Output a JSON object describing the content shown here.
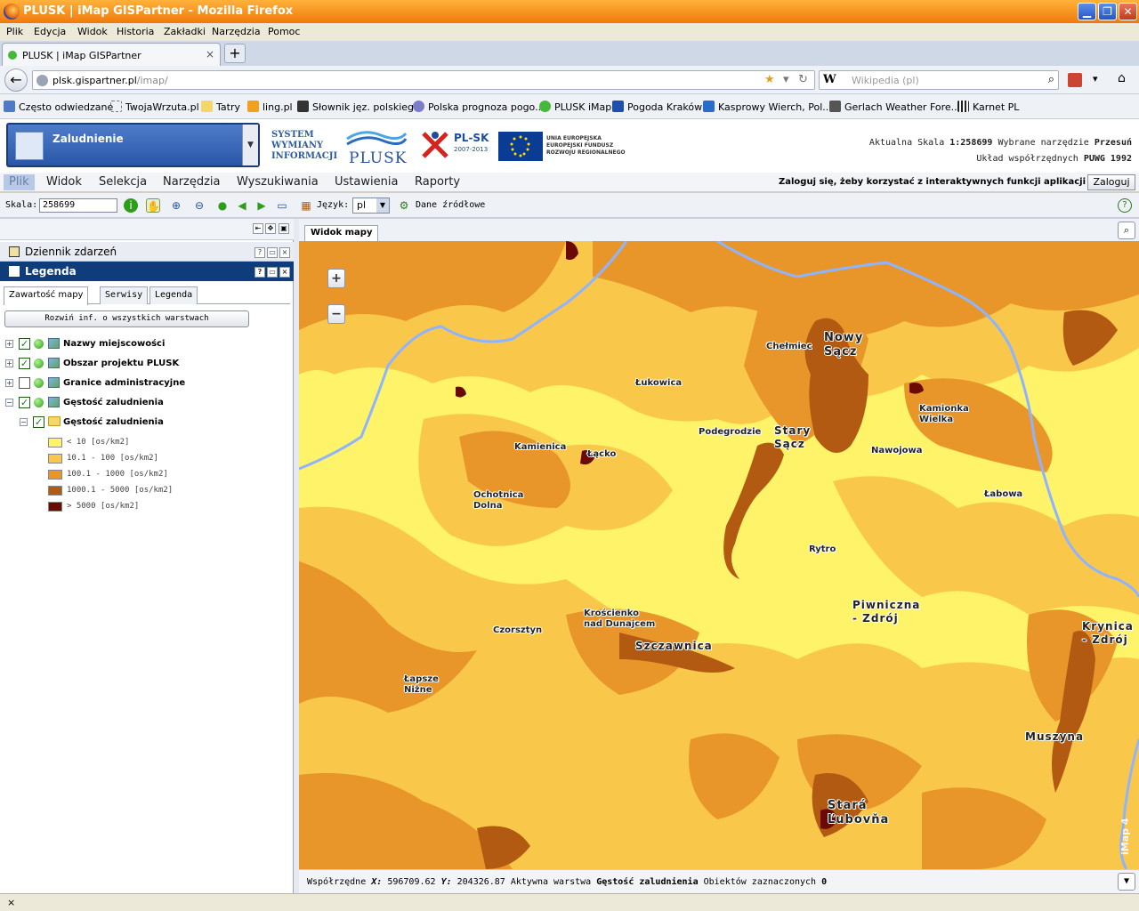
{
  "window": {
    "title": "PLUSK | iMap GISPartner - Mozilla Firefox"
  },
  "menu": [
    "Plik",
    "Edycja",
    "Widok",
    "Historia",
    "Zakładki",
    "Narzędzia",
    "Pomoc"
  ],
  "tab": {
    "label": "PLUSK | iMap GISPartner",
    "new": "+"
  },
  "nav": {
    "url_host": "plsk.gispartner.pl",
    "url_path": "/imap/",
    "search_engine": "W",
    "search_placeholder": "Wikipedia (pl)"
  },
  "bookmarks": [
    "Często odwiedzane",
    "TwojaWrzuta.pl",
    "Tatry",
    "ling.pl",
    "Słownik jęz. polskiego",
    "Polska prognoza pogo...",
    "PLUSK iMap",
    "Pogoda Kraków",
    "Kasprowy Wierch, Pol...",
    "Gerlach Weather Fore...",
    "Karnet PL"
  ],
  "app": {
    "combo_label": "Zaludnienie",
    "system_lines": [
      "SYSTEM",
      "WYMIANY",
      "INFORMACJI"
    ],
    "plusk_logo": "PLUSK",
    "plsk_logo": "PL-SK",
    "plsk_years": "2007-2013",
    "eu_lines": [
      "UNIA EUROPEJSKA",
      "EUROPEJSKI FUNDUSZ",
      "ROZWOJU REGIONALNEGO"
    ],
    "scale_label": "Aktualna Skala",
    "scale_value": "1:258699",
    "tool_label": "Wybrane narzędzie",
    "tool_value": "Przesuń",
    "coords_label": "Układ współrzędnych",
    "coords_value": "PUWG 1992"
  },
  "appmenu": [
    "Plik",
    "Widok",
    "Selekcja",
    "Narzędzia",
    "Wyszukiwania",
    "Ustawienia",
    "Raporty"
  ],
  "login": {
    "text": "Zaloguj się, żeby korzystać z interaktywnych funkcji aplikacji",
    "button": "Zaloguj"
  },
  "toolbar": {
    "scale_label": "Skala:",
    "scale_value": "258699",
    "lang_label": "Język:",
    "lang_value": "pl",
    "source_label": "Dane źródłowe"
  },
  "left": {
    "events": "Dziennik zdarzeń",
    "legend": "Legenda",
    "subtabs": [
      "Zawartość mapy",
      "Serwisy",
      "Legenda"
    ],
    "expand_all": "Rozwiń inf. o wszystkich warstwach",
    "layers": [
      {
        "name": "Nazwy miejscowości",
        "checked": true
      },
      {
        "name": "Obszar projektu PLUSK",
        "checked": true
      },
      {
        "name": "Granice administracyjne",
        "checked": false
      },
      {
        "name": "Gęstość zaludnienia",
        "checked": true
      }
    ],
    "sublayer": "Gęstość zaludnienia",
    "legend_items": [
      {
        "label": "< 10 [os/km2]",
        "color": "#fff36a"
      },
      {
        "label": "10.1 - 100 [os/km2]",
        "color": "#f9c84b"
      },
      {
        "label": "100.1 - 1000 [os/km2]",
        "color": "#e8962a"
      },
      {
        "label": "1000.1 - 5000 [os/km2]",
        "color": "#b35a12"
      },
      {
        "label": "> 5000 [os/km2]",
        "color": "#6b0a05"
      }
    ]
  },
  "map": {
    "tab": "Widok mapy",
    "zoom_in": "+",
    "zoom_out": "−",
    "watermark": "iMap 4",
    "places": [
      {
        "n": "Nowy\nSącz",
        "s": "big"
      },
      {
        "n": "Chełmiec",
        "s": ""
      },
      {
        "n": "Łukowica",
        "s": ""
      },
      {
        "n": "Kamionka\nWielka",
        "s": ""
      },
      {
        "n": "Podegrodzie",
        "s": ""
      },
      {
        "n": "Stary\nSącz",
        "s": "mid"
      },
      {
        "n": "Kamienica",
        "s": ""
      },
      {
        "n": "Łącko",
        "s": ""
      },
      {
        "n": "Nawojowa",
        "s": ""
      },
      {
        "n": "Ochotnica\nDolna",
        "s": ""
      },
      {
        "n": "Łabowa",
        "s": ""
      },
      {
        "n": "Rytro",
        "s": ""
      },
      {
        "n": "Piwniczna\n- Zdrój",
        "s": "mid"
      },
      {
        "n": "Krościenko\nnad Dunajcem",
        "s": ""
      },
      {
        "n": "Czorsztyn",
        "s": ""
      },
      {
        "n": "Szczawnica",
        "s": "mid"
      },
      {
        "n": "Krynica\n- Zdrój",
        "s": "mid"
      },
      {
        "n": "Łapsze\nNiżne",
        "s": ""
      },
      {
        "n": "Muszyna",
        "s": "mid"
      },
      {
        "n": "Stará\nĽubovňa",
        "s": "big"
      }
    ]
  },
  "status": {
    "coords_label": "Współrzędne",
    "x_label": "X:",
    "x_value": "596709.62",
    "y_label": "Y:",
    "y_value": "204326.87",
    "layer_label": "Aktywna warstwa",
    "layer_value": "Gęstość zaludnienia",
    "selected_label": "Obiektów zaznaczonych",
    "selected_value": "0"
  },
  "ffstatus": "×"
}
